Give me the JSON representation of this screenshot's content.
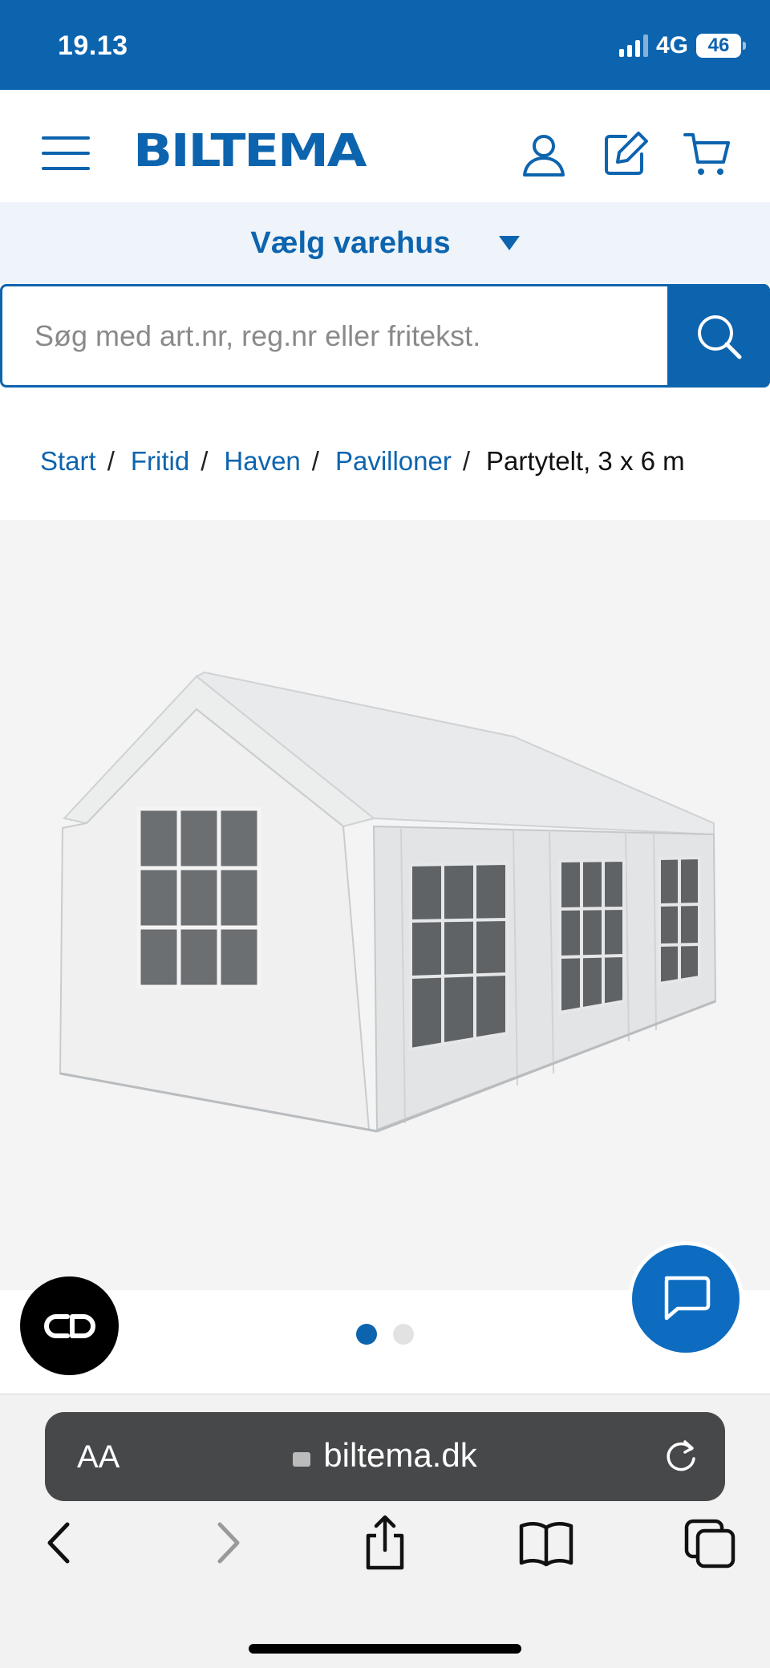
{
  "status_bar": {
    "time": "19.13",
    "network": "4G",
    "battery": "46"
  },
  "header": {
    "logo": "BILTEMA",
    "icons": [
      "menu-icon",
      "user-icon",
      "edit-icon",
      "cart-icon"
    ]
  },
  "store_selector": {
    "label": "Vælg varehus"
  },
  "search": {
    "placeholder": "Søg med art.nr, reg.nr eller fritekst."
  },
  "breadcrumb": {
    "items": [
      "Start",
      "Fritid",
      "Haven",
      "Pavilloner"
    ],
    "separator": "/",
    "current": "Partytelt, 3 x 6 m"
  },
  "gallery": {
    "image_alt": "Partytelt, 3 x 6 m",
    "slides": 2,
    "active_slide": 1
  },
  "browser": {
    "text_size": "AA",
    "url": "biltema.dk"
  },
  "colors": {
    "brand_blue": "#0d64ae",
    "chat_blue": "#0d6cc0",
    "store_bar_bg": "#eef4f9"
  }
}
